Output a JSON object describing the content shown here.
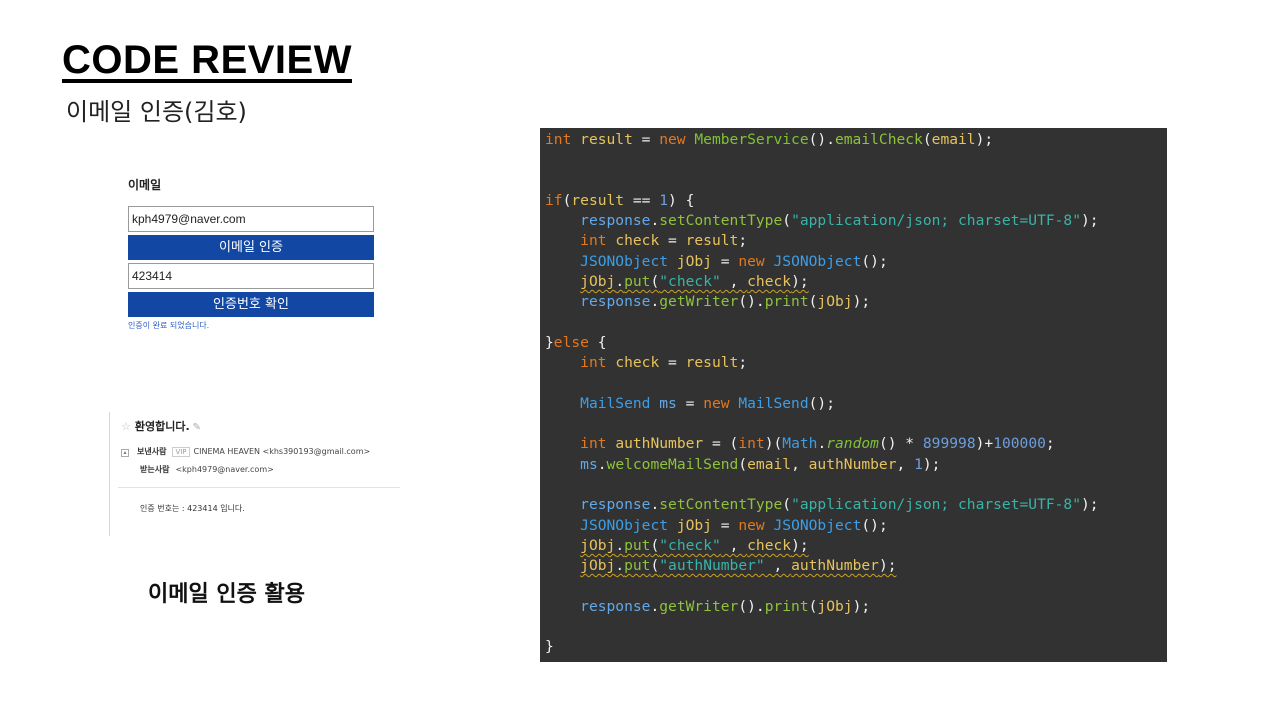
{
  "slide": {
    "title": "CODE REVIEW",
    "subtitle": "이메일 인증(김호)",
    "caption": "이메일 인증 활용"
  },
  "email_form": {
    "label": "이메일",
    "email_value": "kph4979@naver.com",
    "verify_button": "이메일 인증",
    "code_value": "423414",
    "confirm_button": "인증번호 확인",
    "status_message": "인증이 완료 되었습니다."
  },
  "mail_view": {
    "subject": "환영합니다.",
    "sender_label": "보낸사람",
    "vip_badge": "VIP",
    "sender": "CINEMA HEAVEN <khs390193@gmail.com>",
    "recipient_label": "받는사람",
    "recipient": "<kph4979@naver.com>",
    "body": "인증 번호는 : 423414 입니다."
  },
  "colors": {
    "button_blue": "#1247a4",
    "code_background": "#323232"
  },
  "code": {
    "lines": [
      "int result = new MemberService().emailCheck(email);",
      "",
      "",
      "if(result == 1) {",
      "    response.setContentType(\"application/json; charset=UTF-8\");",
      "    int check = result;",
      "    JSONObject jObj = new JSONObject();",
      "    jObj.put(\"check\" , check);",
      "    response.getWriter().print(jObj);",
      "",
      "}else {",
      "    int check = result;",
      "",
      "    MailSend ms = new MailSend();",
      "",
      "    int authNumber = (int)(Math.random() * 899998)+100000;",
      "    ms.welcomeMailSend(email, authNumber, 1);",
      "",
      "    response.setContentType(\"application/json; charset=UTF-8\");",
      "    JSONObject jObj = new JSONObject();",
      "    jObj.put(\"check\" , check);",
      "    jObj.put(\"authNumber\" , authNumber);",
      "",
      "    response.getWriter().print(jObj);",
      "",
      "}"
    ]
  }
}
